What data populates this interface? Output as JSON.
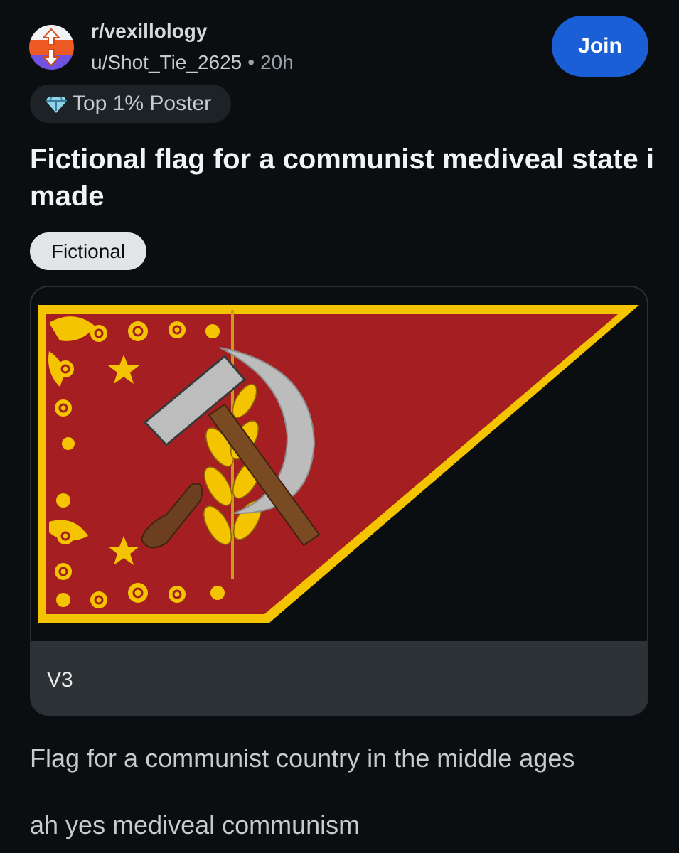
{
  "header": {
    "subreddit": "r/vexillology",
    "username": "u/Shot_Tie_2625",
    "separator": "•",
    "age": "20h",
    "join_label": "Join"
  },
  "badge": {
    "icon": "diamond-icon",
    "label": "Top 1% Poster"
  },
  "post": {
    "title": "Fictional flag for a communist mediveal state i made",
    "flair": "Fictional",
    "image_caption": "V3",
    "body": [
      "Flag for a communist country in the middle ages",
      "ah yes mediveal communism"
    ]
  },
  "colors": {
    "flag_red": "#a51e22",
    "flag_gold": "#f5c400",
    "join_blue": "#1a5fd6",
    "background": "#0b0e11"
  }
}
